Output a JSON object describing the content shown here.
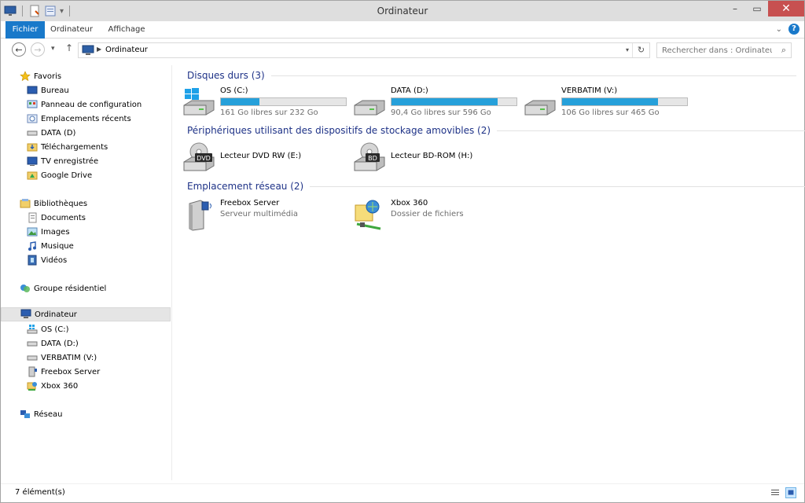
{
  "window": {
    "title": "Ordinateur"
  },
  "ribbon": {
    "tabs": [
      {
        "label": "Fichier"
      },
      {
        "label": "Ordinateur"
      },
      {
        "label": "Affichage"
      }
    ]
  },
  "address": {
    "crumb": "Ordinateur",
    "search_placeholder": "Rechercher dans : Ordinateur"
  },
  "sidebar": {
    "favorites": "Favoris",
    "fav_items": [
      "Bureau",
      "Panneau de configuration",
      "Emplacements récents",
      "DATA (D)",
      "Téléchargements",
      "TV enregistrée",
      "Google Drive"
    ],
    "libraries": "Bibliothèques",
    "lib_items": [
      "Documents",
      "Images",
      "Musique",
      "Vidéos"
    ],
    "homegroup": "Groupe résidentiel",
    "computer": "Ordinateur",
    "comp_items": [
      "OS (C:)",
      "DATA (D:)",
      "VERBATIM (V:)",
      "Freebox Server",
      "Xbox 360"
    ],
    "network": "Réseau"
  },
  "groups": {
    "hard_disks": "Disques durs (3)",
    "removable": "Périphériques utilisant des dispositifs de stockage amovibles (2)",
    "network": "Emplacement réseau (2)"
  },
  "drives": [
    {
      "name": "OS (C:)",
      "free": "161 Go libres sur 232 Go",
      "used_fraction": 0.31
    },
    {
      "name": "DATA (D:)",
      "free": "90,4 Go libres sur 596 Go",
      "used_fraction": 0.85
    },
    {
      "name": "VERBATIM (V:)",
      "free": "106 Go libres sur 465 Go",
      "used_fraction": 0.77
    }
  ],
  "removable": [
    {
      "name": "Lecteur DVD RW (E:)",
      "badge": "DVD"
    },
    {
      "name": "Lecteur BD-ROM (H:)",
      "badge": "BD"
    }
  ],
  "network_locations": [
    {
      "name": "Freebox Server",
      "sub": "Serveur multimédia"
    },
    {
      "name": "Xbox 360",
      "sub": "Dossier de fichiers"
    }
  ],
  "status": {
    "count": "7 élément(s)"
  },
  "colors": {
    "accent": "#1979ca",
    "bar": "#26a0da",
    "group_title": "#1e3287"
  }
}
